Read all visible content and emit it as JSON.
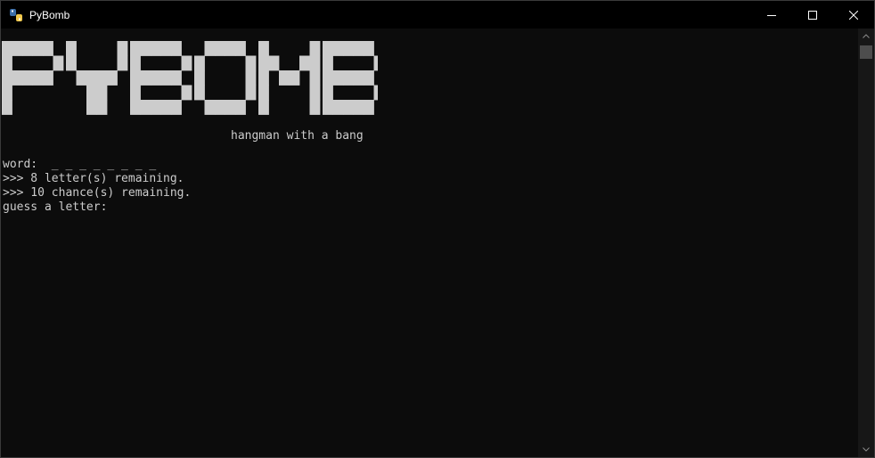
{
  "window": {
    "title": "PyBomb",
    "controls": [
      "minimize",
      "maximize",
      "close"
    ]
  },
  "console": {
    "banner": "PYBOMB",
    "subtitle": "hangman with a bang",
    "lines": [
      "word:  _ _ _ _ _ _ _ _",
      ">>> 8 letter(s) remaining.",
      ">>> 10 chance(s) remaining.",
      "guess a letter:"
    ]
  },
  "colors": {
    "background": "#0c0c0c",
    "text": "#cccccc",
    "titlebar": "#000000"
  },
  "icons": {
    "app": "python-icon",
    "minimize": "minimize-icon",
    "maximize": "maximize-icon",
    "close": "close-icon",
    "scroll_up": "chevron-up-icon",
    "scroll_down": "chevron-down-icon"
  }
}
